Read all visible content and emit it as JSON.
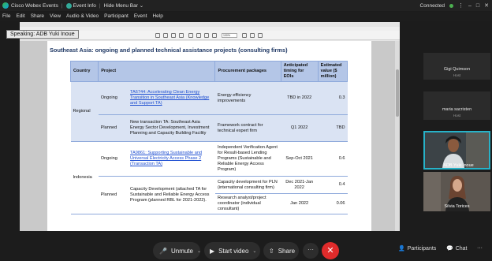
{
  "topbar": {
    "app_name": "Cisco Webex Events",
    "event_info": "Event Info",
    "hide_menu_bar": "Hide Menu Bar",
    "connection_status": "Connected",
    "minimize": "–",
    "maximize": "□",
    "close": "✕"
  },
  "menu": [
    "File",
    "Edit",
    "Share",
    "View",
    "Audio & Video",
    "Participant",
    "Event",
    "Help"
  ],
  "speaking": "Speaking: ADB Yuki Inoue",
  "doc": {
    "zoom": "100%",
    "slide_title": "Southeast Asia: ongoing and planned technical assistance projects (consulting firms)"
  },
  "table": {
    "headers": {
      "country": "Country",
      "project": "Project",
      "packages": "Procurement packages",
      "timing": "Anticipated timing for EOIs",
      "value": "Estimated value ($ million)"
    },
    "regional": {
      "country": "Regional",
      "ongoing_status": "Ongoing",
      "ongoing_project": "TA6744: Accelerating Clean Energy Transition in Southeast Asia (Knowledge and Support TA)",
      "ongoing_package": "Energy efficiency improvements",
      "ongoing_timing": "TBD in 2022",
      "ongoing_value": "0.3",
      "planned_status": "Planned",
      "planned_project": "New transaction TA: Southeast Asia Energy Sector Development, Investment Planning and Capacity Building Facility",
      "planned_package": "Framework contract for technical expert firm",
      "planned_timing": "Q1 2022",
      "planned_value": "TBD"
    },
    "indonesia": {
      "country": "Indonesia",
      "ongoing_status": "Ongoing",
      "ongoing_project": "TA9861: Supporting Sustainable and Universal Electricity Access Phase 2 (Transaction TA)",
      "ongoing_package": "Independent Verification Agent for Result-based Lending Programs (Sustainable and Reliable Energy Access Program)",
      "ongoing_timing": "Sep-Oct 2021",
      "ongoing_value": "0.6",
      "planned_status": "Planned",
      "planned_project": "Capacity Development (attached TA for Sustainable and Reliable Energy Access Program (planned RBL for 2021-2022).",
      "planned_package_1": "Capacity development for PLN (international consulting firm)",
      "planned_timing_1": "Dec 2021-Jan 2022",
      "planned_value_1": "0.4",
      "planned_package_2": "Research analyst/project coordinator (individual consultant)",
      "planned_timing_2": "Jan 2022",
      "planned_value_2": "0.06"
    }
  },
  "participants": [
    {
      "name": "Gigi Quimson",
      "role": "Host"
    },
    {
      "name": "maria sacristen",
      "role": "Host"
    },
    {
      "name": "ADB Yuki Inoue",
      "role": ""
    },
    {
      "name": "Silvia Torices",
      "role": ""
    }
  ],
  "controls": {
    "unmute": "Unmute",
    "start_video": "Start video",
    "share": "Share",
    "more": "···",
    "participants": "Participants",
    "chat": "Chat",
    "more_right": "···"
  }
}
